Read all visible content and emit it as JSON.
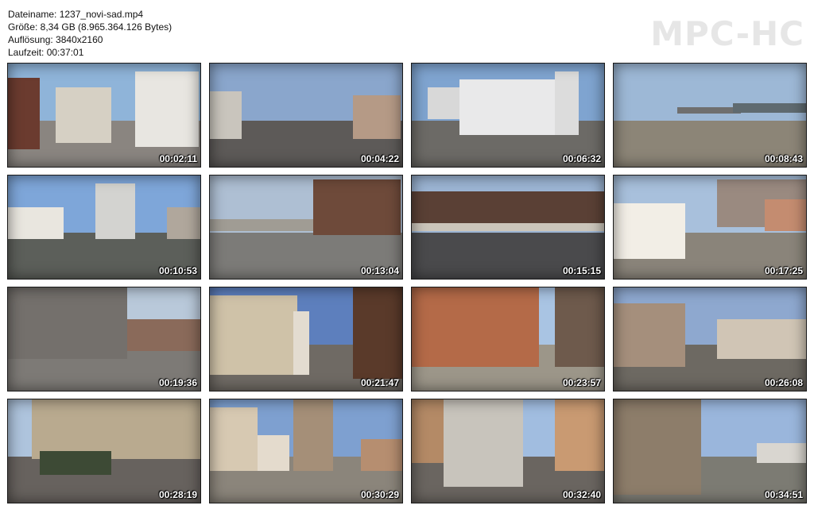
{
  "file_info": {
    "filename": "Dateiname: 1237_novi-sad.mp4",
    "size": "Größe: 8,34 GB (8.965.364.126 Bytes)",
    "resolution": "Auflösung: 3840x2160",
    "duration": "Laufzeit: 00:37:01"
  },
  "logo": "MPC-HC",
  "thumbnails": [
    {
      "time": "00:02:11",
      "sky": "#8fb4d9",
      "ground": "#8a8580",
      "scene": "arcade"
    },
    {
      "time": "00:04:22",
      "sky": "#8aa6cc",
      "ground": "#5d5a58",
      "scene": "arches"
    },
    {
      "time": "00:06:32",
      "sky": "#7fa4d0",
      "ground": "#6c6a66",
      "scene": "offices"
    },
    {
      "time": "00:08:43",
      "sky": "#9db8d6",
      "ground": "#8c8577",
      "scene": "river"
    },
    {
      "time": "00:10:53",
      "sky": "#7ea6d9",
      "ground": "#5c5f5a",
      "scene": "boulevard"
    },
    {
      "time": "00:13:04",
      "sky": "#aebfd3",
      "ground": "#7c7b78",
      "scene": "crossing"
    },
    {
      "time": "00:15:15",
      "sky": "#9cb5d4",
      "ground": "#4a4a4c",
      "scene": "market"
    },
    {
      "time": "00:17:25",
      "sky": "#a8c0dc",
      "ground": "#8a847a",
      "scene": "kiosk"
    },
    {
      "time": "00:19:36",
      "sky": "#b9c9da",
      "ground": "#7d7a76",
      "scene": "mural"
    },
    {
      "time": "00:21:47",
      "sky": "#5d7fbd",
      "ground": "#6f6a64",
      "scene": "church-street"
    },
    {
      "time": "00:23:57",
      "sky": "#a9c4e3",
      "ground": "#9c9689",
      "scene": "palace"
    },
    {
      "time": "00:26:08",
      "sky": "#8ea8cf",
      "ground": "#6d6962",
      "scene": "pedestrian"
    },
    {
      "time": "00:28:19",
      "sky": "#aec4dd",
      "ground": "#67625e",
      "scene": "newsstand"
    },
    {
      "time": "00:30:29",
      "sky": "#7ea0d0",
      "ground": "#8b857b",
      "scene": "cathedral"
    },
    {
      "time": "00:32:40",
      "sky": "#a1bde0",
      "ground": "#6a6560",
      "scene": "sculpture"
    },
    {
      "time": "00:34:51",
      "sky": "#9ab6dc",
      "ground": "#7c7b73",
      "scene": "trees"
    }
  ]
}
